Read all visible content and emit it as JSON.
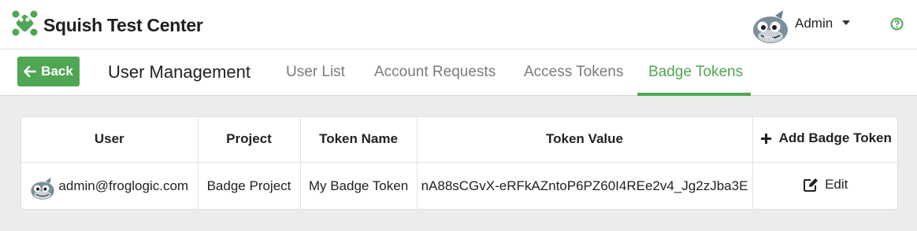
{
  "app": {
    "title": "Squish Test Center"
  },
  "user_menu": {
    "name": "Admin"
  },
  "nav": {
    "back_label": "Back",
    "section_title": "User Management",
    "tabs": [
      {
        "label": "User List"
      },
      {
        "label": "Account Requests"
      },
      {
        "label": "Access Tokens"
      },
      {
        "label": "Badge Tokens",
        "active": true
      }
    ]
  },
  "table": {
    "columns": [
      "User",
      "Project",
      "Token Name",
      "Token Value"
    ],
    "add_label": "Add Badge Token",
    "rows": [
      {
        "user": "admin@froglogic.com",
        "project": "Badge Project",
        "token_name": "My Badge Token",
        "token_value": "nA88sCGvX-eRFkAZntoP6PZ60I4REe2v4_Jg2zJba3E",
        "edit_label": "Edit"
      }
    ]
  },
  "colors": {
    "accent": "#4fa653",
    "background": "#ececec"
  }
}
